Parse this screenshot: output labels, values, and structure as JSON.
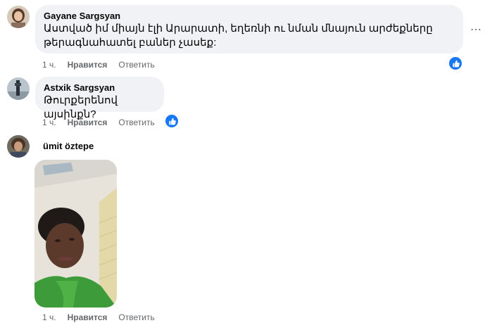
{
  "comments": [
    {
      "author": "Gayane Sargsyan",
      "text_line1": "Աստված իմ միայն էլի Արարատի, եղեռնի ու նման մնայուն արժեքները",
      "text_line2": "թերագնահատել բաներ չասեք:",
      "time": "1 ч.",
      "like": "Нравится",
      "reply": "Ответить",
      "more_glyph": "⋯",
      "reaction": "like"
    },
    {
      "author": "Astxik Sargsyan",
      "text": "Թուրքերենով այսինքն?",
      "time": "1 ч.",
      "like": "Нравится",
      "reply": "Ответить",
      "reaction": "like"
    },
    {
      "author": "ümit öztepe",
      "time": "1 ч.",
      "like": "Нравится",
      "reply": "Ответить"
    }
  ],
  "colors": {
    "bubble": "#f0f2f5",
    "meta": "#65676b",
    "like_blue": "#1877f2"
  }
}
